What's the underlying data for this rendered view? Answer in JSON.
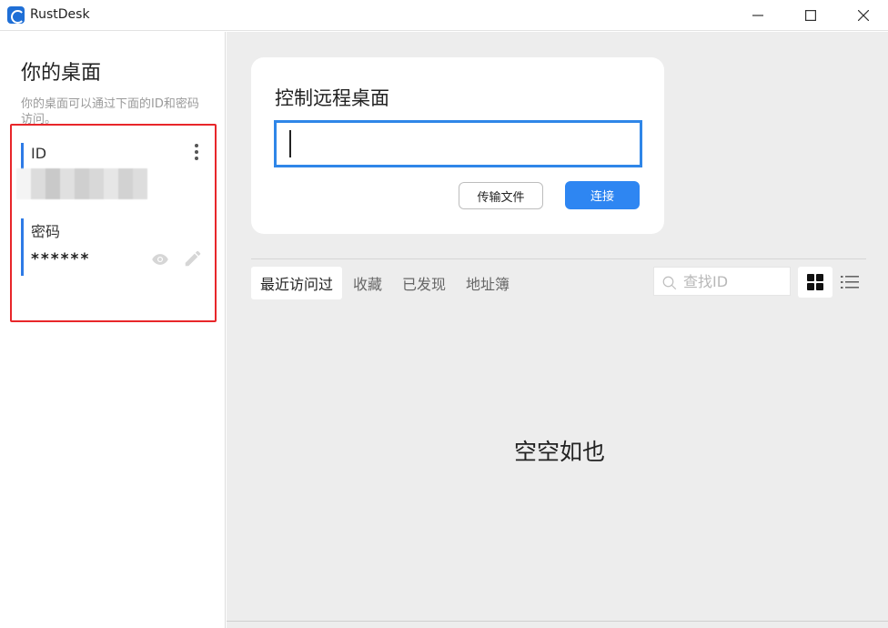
{
  "window": {
    "title": "RustDesk",
    "icons": [
      "rustdesk-logo",
      "minimize-icon",
      "maximize-icon",
      "close-icon"
    ]
  },
  "left_panel": {
    "title": "你的桌面",
    "description": "你的桌面可以通过下面的ID和密码访问。",
    "id_label": "ID",
    "password_label": "密码",
    "password_value": "******",
    "accent_color": "#2e7be6",
    "highlight_color": "#e8262a"
  },
  "connect_card": {
    "title": "控制远程桌面",
    "id_input_value": "",
    "transfer_button": "传输文件",
    "connect_button": "连接",
    "connect_color": "#2e86f2"
  },
  "peers": {
    "tabs": [
      {
        "label": "最近访问过",
        "active": true
      },
      {
        "label": "收藏",
        "active": false
      },
      {
        "label": "已发现",
        "active": false
      },
      {
        "label": "地址簿",
        "active": false
      }
    ],
    "search_placeholder": "查找ID",
    "view_modes": [
      "grid-view-icon",
      "list-view-icon"
    ],
    "empty_message": "空空如也"
  }
}
